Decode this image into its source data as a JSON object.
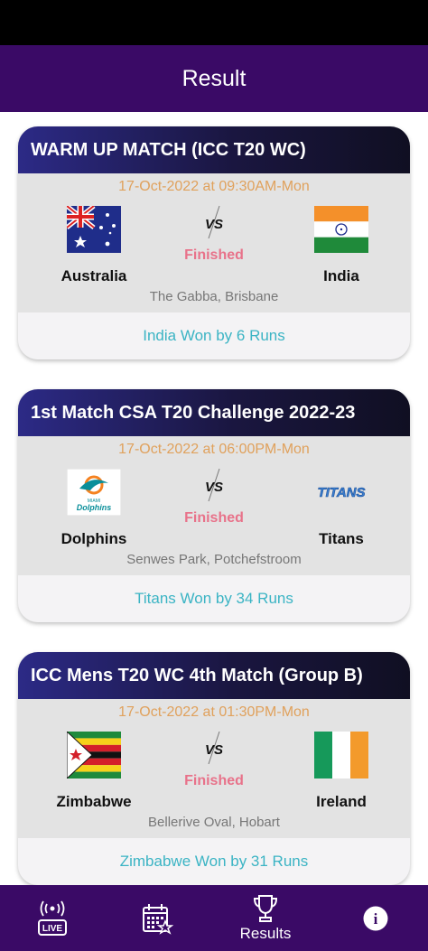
{
  "app": {
    "title": "Result"
  },
  "matches": [
    {
      "title": "WARM UP MATCH (ICC T20 WC)",
      "datetime": "17-Oct-2022 at 09:30AM-Mon",
      "team1": {
        "name": "Australia",
        "flag": "australia-flag"
      },
      "team2": {
        "name": "India",
        "flag": "india-flag"
      },
      "status": "Finished",
      "venue": "The Gabba, Brisbane",
      "result": "India Won by 6 Runs"
    },
    {
      "title": "1st Match CSA T20 Challenge 2022-23",
      "datetime": "17-Oct-2022 at 06:00PM-Mon",
      "team1": {
        "name": "Dolphins",
        "flag": "dolphins-logo",
        "logo_text": "Dolphins",
        "logo_small_text": "MIAMI"
      },
      "team2": {
        "name": "Titans",
        "flag": "titans-logo",
        "logo_text": "TITANS"
      },
      "status": "Finished",
      "venue": "Senwes Park, Potchefstroom",
      "result": "Titans Won by 34 Runs"
    },
    {
      "title": "ICC Mens T20 WC 4th Match (Group B)",
      "datetime": "17-Oct-2022 at 01:30PM-Mon",
      "team1": {
        "name": "Zimbabwe",
        "flag": "zimbabwe-flag"
      },
      "team2": {
        "name": "Ireland",
        "flag": "ireland-flag"
      },
      "status": "Finished",
      "venue": "Bellerive Oval, Hobart",
      "result": "Zimbabwe Won by 31 Runs"
    }
  ],
  "vs_text": "VS",
  "bottom_nav": {
    "live_badge": "LIVE",
    "results_label": "Results",
    "icons": [
      "live-icon",
      "calendar-icon",
      "trophy-icon",
      "info-icon"
    ],
    "info_glyph": "i"
  },
  "colors": {
    "appbar": "#3a0a66",
    "datetime": "#e0a15c",
    "status": "#e8728a",
    "result": "#3bb4c4"
  }
}
